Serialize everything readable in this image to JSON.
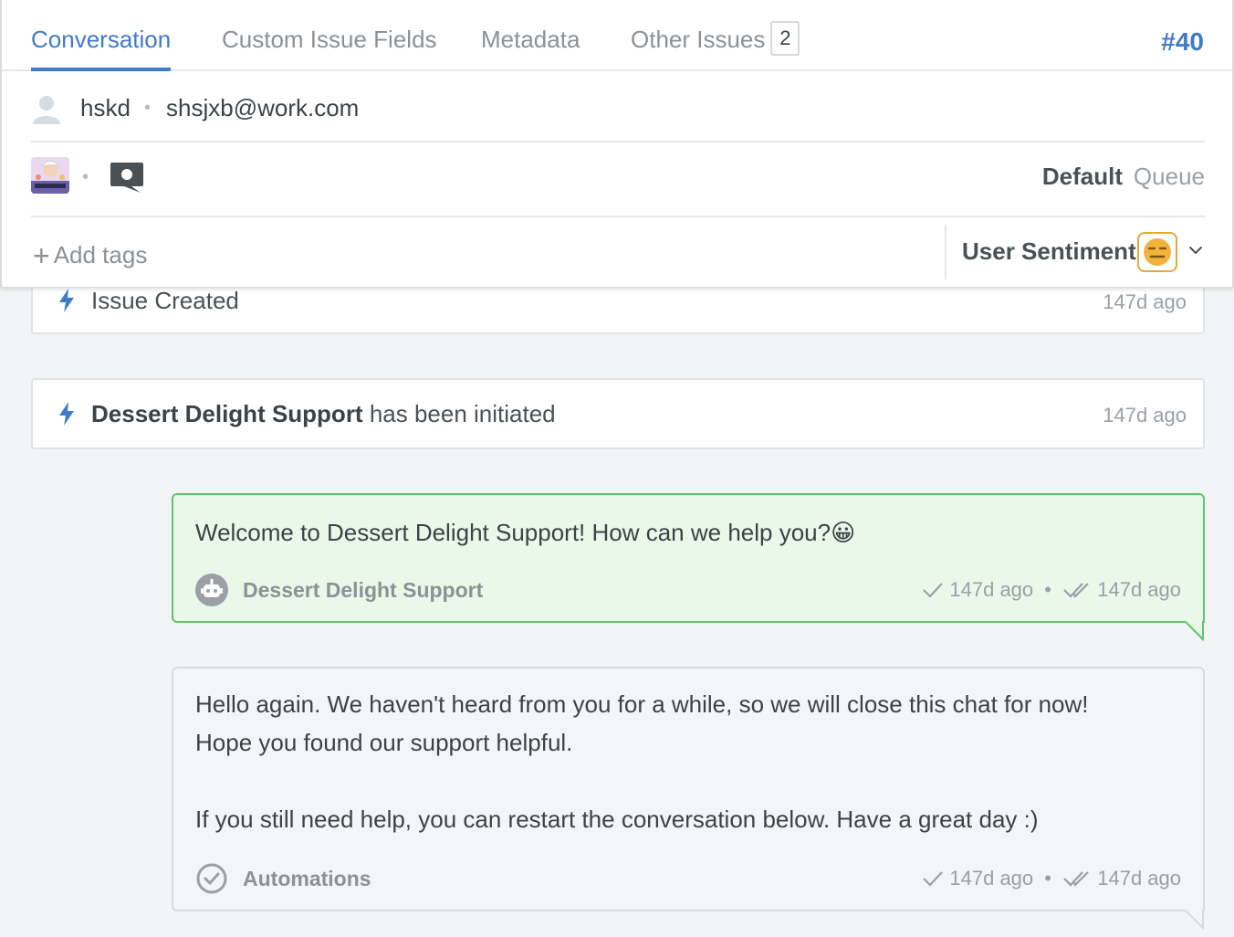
{
  "tabs": [
    {
      "label": "Conversation"
    },
    {
      "label": "Custom Issue Fields"
    },
    {
      "label": "Metadata"
    },
    {
      "label": "Other Issues",
      "badge": "2"
    }
  ],
  "issue_number": "#40",
  "user": {
    "name": "hskd",
    "separator": "•",
    "email": "shsjxb@work.com"
  },
  "meta": {
    "separator": "•",
    "queue_name": "Default",
    "queue_label": "Queue"
  },
  "tags": {
    "add_label": "Add tags",
    "plus": "+"
  },
  "sentiment": {
    "label": "User Sentiment"
  },
  "events": [
    {
      "text": "Issue Created",
      "time": "147d ago"
    },
    {
      "bold": "Dessert Delight Support",
      "text": " has been initiated",
      "time": "147d ago"
    }
  ],
  "messages": [
    {
      "text": "Welcome to Dessert Delight Support! How can we help you?😀",
      "sender": "Dessert Delight Support",
      "sent_time": "147d ago",
      "sep": "•",
      "read_time": "147d ago"
    },
    {
      "text": "Hello again. We haven't heard from you for a while, so we will close this chat for now!\nHope you found our support helpful.\n\nIf you still need help, you can restart the conversation below. Have a great day :)",
      "sender": "Automations",
      "sent_time": "147d ago",
      "sep": "•",
      "read_time": "147d ago"
    }
  ],
  "colors": {
    "accent": "#3f7bc8",
    "bot_bubble_bg": "#eaf8ea",
    "bot_bubble_border": "#63c36c",
    "sentiment": "#e5a93a"
  },
  "icons": {
    "user": "person-avatar-icon",
    "brand": "dessert-delight-logo",
    "channel": "chat-bubble-icon",
    "event": "lightning-bolt-icon",
    "bot": "robot-icon",
    "automation": "check-circle-icon",
    "sentiment": "neutral-face-icon"
  }
}
